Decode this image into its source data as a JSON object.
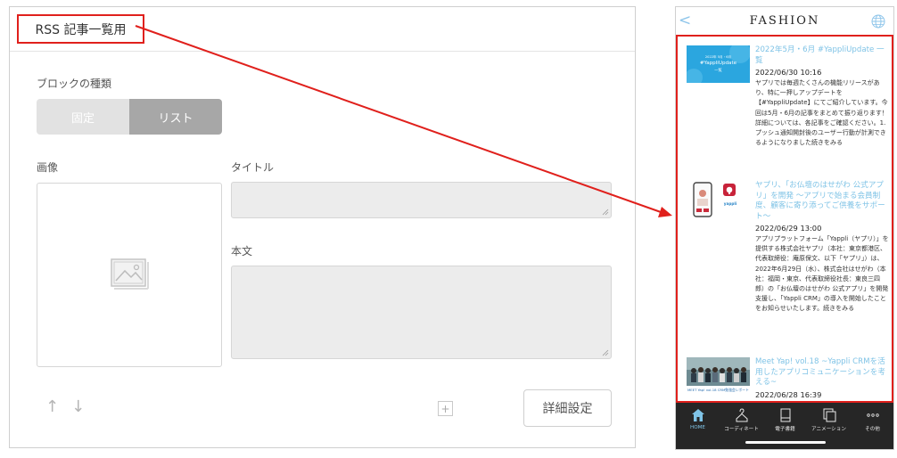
{
  "editor": {
    "title": "RSS 記事一覧用",
    "block_type_label": "ブロックの種類",
    "segment": {
      "fixed": "固定",
      "list": "リスト"
    },
    "image_label": "画像",
    "title_label": "タイトル",
    "body_label": "本文",
    "move_up": "↑",
    "move_down": "↓",
    "add": "+",
    "detail_button": "詳細設定"
  },
  "colors": {
    "highlight": "#e0201c",
    "accent": "#7fc3e6",
    "tabbar": "#262626"
  },
  "phone": {
    "back": "<",
    "title": "FASHION",
    "items": [
      {
        "thumb_line1": "2022年 5月・6月",
        "thumb_line2": "#YappliUpdate",
        "thumb_line3": "一覧",
        "title": "2022年5月・6月 #YappliUpdate 一覧",
        "date": "2022/06/30 10:16",
        "body": "ヤプリでは毎週たくさんの機能リリースがあり、特に一押しアップデートを【#YappliUpdate】にてご紹介しています。今回は5月・6月の記事をまとめて振り返ります！詳細については、各記事をご確認ください。1. プッシュ通知開封後のユーザー行動が計測できるようになりました続きをみる"
      },
      {
        "thumb_brand": "yappli",
        "title": "ヤプリ、「お仏壇のはせがわ 公式アプリ」を開発 ～アプリで始まる会員制度、顧客に寄り添ってご供養をサポート～",
        "date": "2022/06/29 13:00",
        "body": "アプリプラットフォーム「Yappli（ヤプリ）」を提供する株式会社ヤプリ（本社：東京都港区、代表取締役：庵原保文、以下「ヤプリ」）は、2022年6月29日（水）、株式会社はせがわ（本社：福岡・東京、代表取締役社長：東良三四郎）の「お仏壇のはせがわ 公式アプリ」を開発支援し、「Yappli CRM」の導入を開始したことをお知らせいたします。続きをみる"
      },
      {
        "thumb_caption": "MEET Yap! vol.18 CRM勉強会レポート",
        "title": "Meet Yap! vol.18 ~Yappli CRMを活用したアプリコミュニケーションを考える~",
        "date": "2022/06/28 16:39",
        "body": ""
      }
    ],
    "tabs": [
      {
        "label": "HOME",
        "icon": "home-icon"
      },
      {
        "label": "コーディネート",
        "icon": "hanger-icon"
      },
      {
        "label": "電子書籍",
        "icon": "book-icon"
      },
      {
        "label": "アニメーション",
        "icon": "copy-icon"
      },
      {
        "label": "その他",
        "icon": "more-icon"
      }
    ]
  }
}
